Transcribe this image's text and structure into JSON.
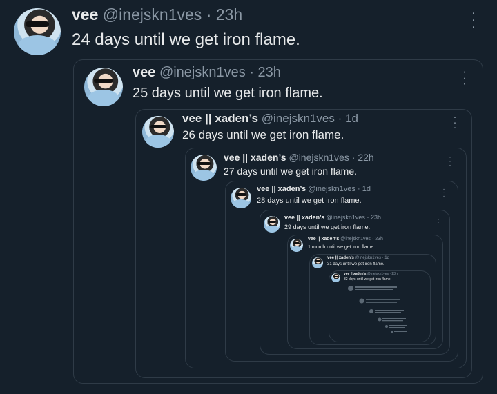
{
  "tweets": [
    {
      "name": "vee",
      "handle": "@inejskn1ves",
      "time": "23h",
      "text": "24 days until we get iron flame."
    },
    {
      "name": "vee",
      "handle": "@inejskn1ves",
      "time": "23h",
      "text": "25 days until we get iron flame."
    },
    {
      "name": "vee || xaden’s",
      "handle": "@inejskn1ves",
      "time": "1d",
      "text": "26 days until we get iron flame."
    },
    {
      "name": "vee || xaden’s",
      "handle": "@inejskn1ves",
      "time": "22h",
      "text": "27 days until we get iron flame."
    },
    {
      "name": "vee || xaden’s",
      "handle": "@inejskn1ves",
      "time": "1d",
      "text": "28 days until we get iron flame."
    },
    {
      "name": "vee || xaden’s",
      "handle": "@inejskn1ves",
      "time": "23h",
      "text": "29 days until we get iron flame."
    },
    {
      "name": "vee || xaden’s",
      "handle": "@inejskn1ves",
      "time": "23h",
      "text": "1 month until we get iron flame."
    },
    {
      "name": "vee || xaden’s",
      "handle": "@inejskn1ves",
      "time": "1d",
      "text": "31 days until we get iron flame."
    },
    {
      "name": "vee || xaden’s",
      "handle": "@inejskn1ves",
      "time": "23h",
      "text": "32 days until we get iron flame."
    }
  ],
  "separator": "·",
  "more_icon": "more-options-icon",
  "colors": {
    "background": "#15202b",
    "text": "#e7e9ea",
    "muted": "#8b98a5",
    "border": "#2f3b47"
  }
}
